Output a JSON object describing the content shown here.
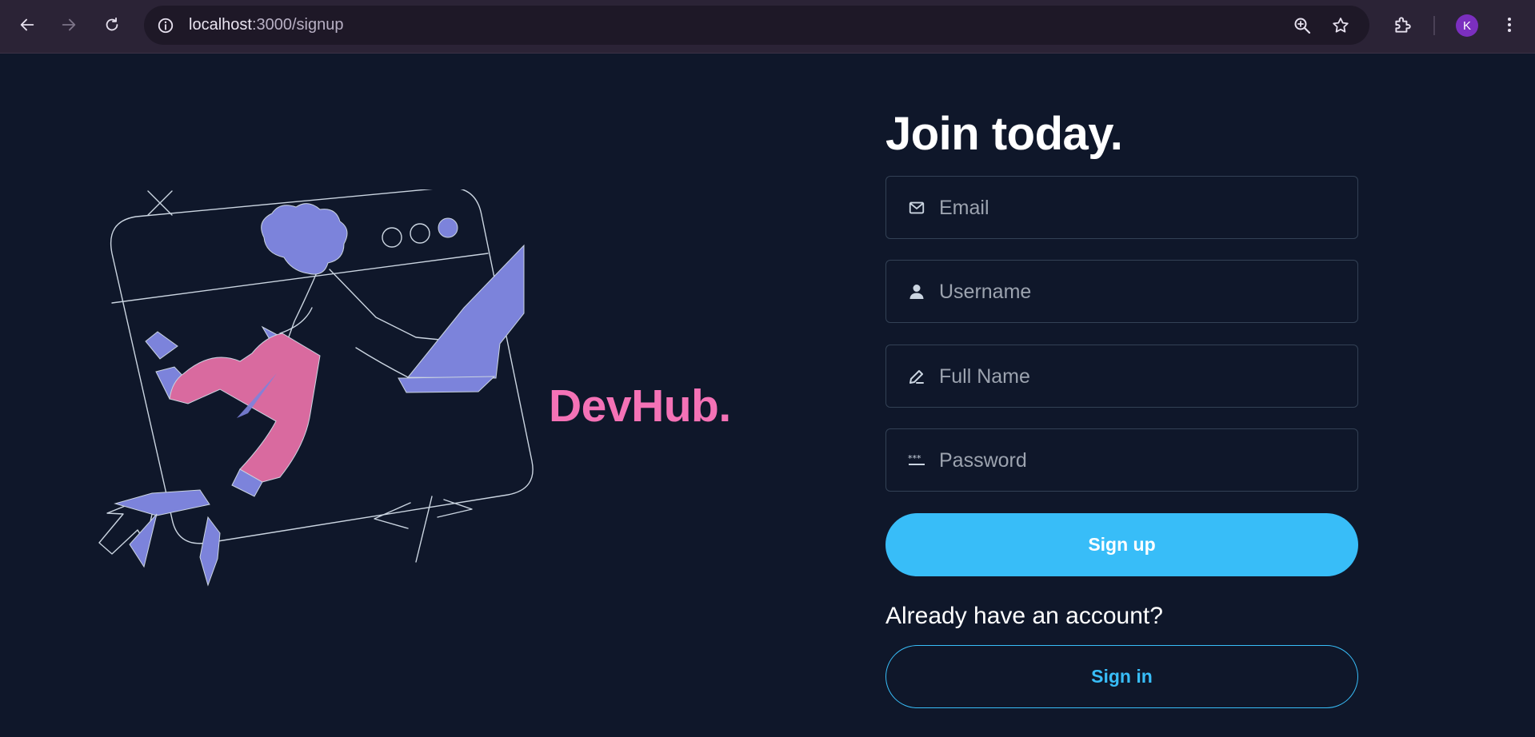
{
  "browser": {
    "url_host": "localhost",
    "url_path": ":3000/signup",
    "profile_initial": "K",
    "icons": [
      "back-arrow-icon",
      "forward-arrow-icon",
      "reload-icon",
      "info-icon",
      "zoom-icon",
      "bookmark-star-icon",
      "extensions-icon",
      "kebab-menu-icon"
    ]
  },
  "hero": {
    "brand": "DevHub."
  },
  "form": {
    "title": "Join today.",
    "fields": [
      {
        "placeholder": "Email",
        "value": "",
        "icon": "envelope-icon"
      },
      {
        "placeholder": "Username",
        "value": "",
        "icon": "user-icon"
      },
      {
        "placeholder": "Full Name",
        "value": "",
        "icon": "pen-icon"
      },
      {
        "placeholder": "Password",
        "value": "",
        "icon": "password-dots-icon"
      }
    ],
    "signup_label": "Sign up",
    "already_text": "Already have an account?",
    "signin_label": "Sign in"
  },
  "colors": {
    "background": "#0f172a",
    "accent": "#38bdf8",
    "brand": "#f472b6",
    "illustration_purple": "#7c83db",
    "illustration_pink": "#d96a9f"
  }
}
